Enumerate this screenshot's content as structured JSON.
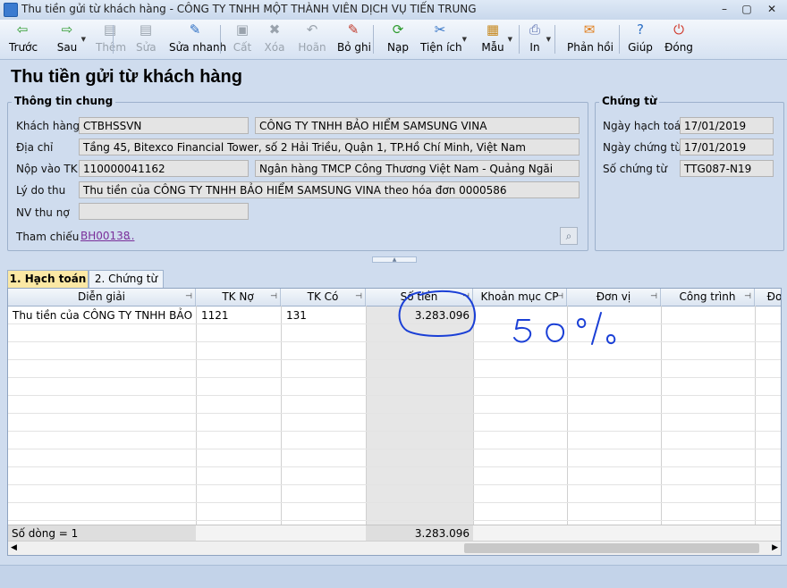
{
  "window": {
    "title": "Thu tiền gửi từ khách hàng - CÔNG TY TNHH MỘT THÀNH VIÊN DỊCH VỤ TIẾN TRUNG",
    "minimize": "–",
    "restore": "▢",
    "close": "✕"
  },
  "toolbar": {
    "items": [
      {
        "label": "Trước",
        "icon": "arrow-left-icon",
        "glyph": "⇦",
        "enabled": true,
        "color": "#2c9a2c"
      },
      {
        "label": "Sau",
        "icon": "arrow-right-icon",
        "glyph": "⇨",
        "enabled": true,
        "color": "#2c9a2c"
      },
      {
        "label": "Thêm",
        "icon": "add-document-icon",
        "glyph": "▤",
        "enabled": false
      },
      {
        "label": "Sửa",
        "icon": "edit-document-icon",
        "glyph": "▤",
        "enabled": false
      },
      {
        "label": "Sửa nhanh",
        "icon": "quick-edit-icon",
        "glyph": "✎",
        "enabled": true,
        "color": "#2d6fc4"
      },
      {
        "label": "Cất",
        "icon": "save-icon",
        "glyph": "▣",
        "enabled": false
      },
      {
        "label": "Xóa",
        "icon": "delete-icon",
        "glyph": "✖",
        "enabled": false
      },
      {
        "label": "Hoãn",
        "icon": "undo-icon",
        "glyph": "↶",
        "enabled": false
      },
      {
        "label": "Bỏ ghi",
        "icon": "unpost-icon",
        "glyph": "✎",
        "enabled": true,
        "color": "#c0392b"
      },
      {
        "label": "Nạp",
        "icon": "reload-icon",
        "glyph": "⟳",
        "enabled": true,
        "color": "#2c9a2c"
      },
      {
        "label": "Tiện ích",
        "icon": "utilities-icon",
        "glyph": "✂",
        "enabled": true,
        "color": "#2d6fc4"
      },
      {
        "label": "Mẫu",
        "icon": "template-icon",
        "glyph": "▦",
        "enabled": true,
        "color": "#c7891f"
      },
      {
        "label": "In",
        "icon": "print-icon",
        "glyph": "⎙",
        "enabled": true,
        "color": "#5a6fb0"
      },
      {
        "label": "Phản hồi",
        "icon": "feedback-icon",
        "glyph": "✉",
        "enabled": true,
        "color": "#e07a14"
      },
      {
        "label": "Giúp",
        "icon": "help-icon",
        "glyph": "?",
        "enabled": true,
        "color": "#2d6fc4"
      },
      {
        "label": "Đóng",
        "icon": "close-power-icon",
        "glyph": "⏻",
        "enabled": true,
        "color": "#d0392b"
      }
    ]
  },
  "page_title": "Thu tiền gửi từ khách hàng",
  "general_info": {
    "group_title": "Thông tin chung",
    "customer_label": "Khách hàng",
    "customer_code": "CTBHSSVN",
    "customer_name": "CÔNG TY TNHH BẢO HIỂM SAMSUNG VINA",
    "address_label": "Địa chỉ",
    "address": "Tầng 45, Bitexco Financial Tower, số 2 Hải Triều, Quận 1, TP.Hồ Chí Minh, Việt Nam",
    "deposit_label": "Nộp vào TK",
    "deposit_account": "110000041162",
    "deposit_bank": "Ngân hàng TMCP Công Thương Việt Nam - Quảng Ngãi",
    "reason_label": "Lý do thu",
    "reason": "Thu tiền của CÔNG TY TNHH BẢO HIỂM SAMSUNG VINA theo hóa đơn 0000586",
    "collector_label": "NV thu nợ",
    "collector": "",
    "reference_label": "Tham chiếu",
    "reference_link": "BH00138",
    "reference_more": "..."
  },
  "voucher": {
    "group_title": "Chứng từ",
    "accounting_date_label": "Ngày hạch toán",
    "accounting_date": "17/01/2019",
    "voucher_date_label": "Ngày chứng từ",
    "voucher_date": "17/01/2019",
    "voucher_no_label": "Số chứng từ",
    "voucher_no": "TTG087-N19"
  },
  "tabs": [
    {
      "label": "1. Hạch toán",
      "active": true
    },
    {
      "label": "2. Chứng từ",
      "active": false
    }
  ],
  "grid": {
    "columns": [
      "Diễn giải",
      "TK Nợ",
      "TK Có",
      "Số tiền",
      "Khoản mục CP",
      "Đơn vị",
      "Công trình",
      "Đơ"
    ],
    "rows": [
      {
        "desc": "Thu tiền của CÔNG TY TNHH BẢO HIỂ",
        "debit": "1121",
        "credit": "131",
        "amount": "3.283.096"
      }
    ],
    "footer_count": "Số dòng = 1",
    "footer_total": "3.283.096"
  },
  "annotation": {
    "handwritten_text": "50%",
    "ink_color": "#1a3fd6"
  }
}
